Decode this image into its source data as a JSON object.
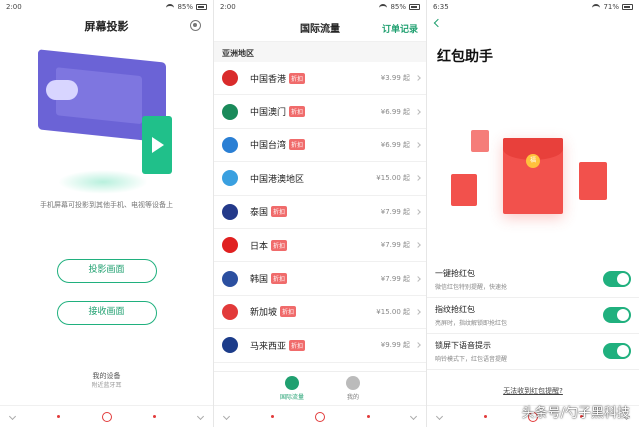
{
  "panel1": {
    "status": {
      "time": "2:00",
      "battery": "85%"
    },
    "title": "屏幕投影",
    "description": "手机屏幕可投影到其他手机、电视等设备上",
    "buttons": {
      "project": "投影画面",
      "receive": "接收画面"
    },
    "my_device": {
      "label": "我的设备",
      "sub": "附近蓝牙耳"
    }
  },
  "panel2": {
    "status": {
      "time": "2:00",
      "battery": "85%"
    },
    "title": "国际流量",
    "order_link": "订单记录",
    "region": "亚洲地区",
    "items": [
      {
        "name": "中国香港",
        "tag": "折扣",
        "price": "¥3.99 起",
        "color": "#d92b2b"
      },
      {
        "name": "中国澳门",
        "tag": "折扣",
        "price": "¥6.99 起",
        "color": "#1a8a5a"
      },
      {
        "name": "中国台湾",
        "tag": "折扣",
        "price": "¥6.99 起",
        "color": "#2a7fd4"
      },
      {
        "name": "中国港澳地区",
        "tag": "",
        "price": "¥15.00 起",
        "color": "#3aa0e0"
      },
      {
        "name": "泰国",
        "tag": "折扣",
        "price": "¥7.99 起",
        "color": "#243a8a"
      },
      {
        "name": "日本",
        "tag": "折扣",
        "price": "¥7.99 起",
        "color": "#e02020"
      },
      {
        "name": "韩国",
        "tag": "折扣",
        "price": "¥7.99 起",
        "color": "#2b4fa0"
      },
      {
        "name": "新加坡",
        "tag": "折扣",
        "price": "¥15.00 起",
        "color": "#e23a3a"
      },
      {
        "name": "马来西亚",
        "tag": "折扣",
        "price": "¥9.99 起",
        "color": "#1c3c8a"
      }
    ],
    "tabs": [
      {
        "label": "国际流量",
        "active": true
      },
      {
        "label": "我的",
        "active": false
      }
    ]
  },
  "panel3": {
    "status": {
      "time": "6:35",
      "battery": "71%"
    },
    "title": "红包助手",
    "coin_text": "福",
    "options": [
      {
        "title": "一键抢红包",
        "desc": "微信红包特别提醒，快速抢",
        "on": true
      },
      {
        "title": "指纹抢红包",
        "desc": "亮屏时，指纹解锁即抢红包",
        "on": true
      },
      {
        "title": "锁屏下语音提示",
        "desc": "响铃模式下，红包语音提醒",
        "on": true
      }
    ],
    "help_link": "无法收到红包提醒?"
  },
  "watermark": "头条号/勺子黑科技"
}
